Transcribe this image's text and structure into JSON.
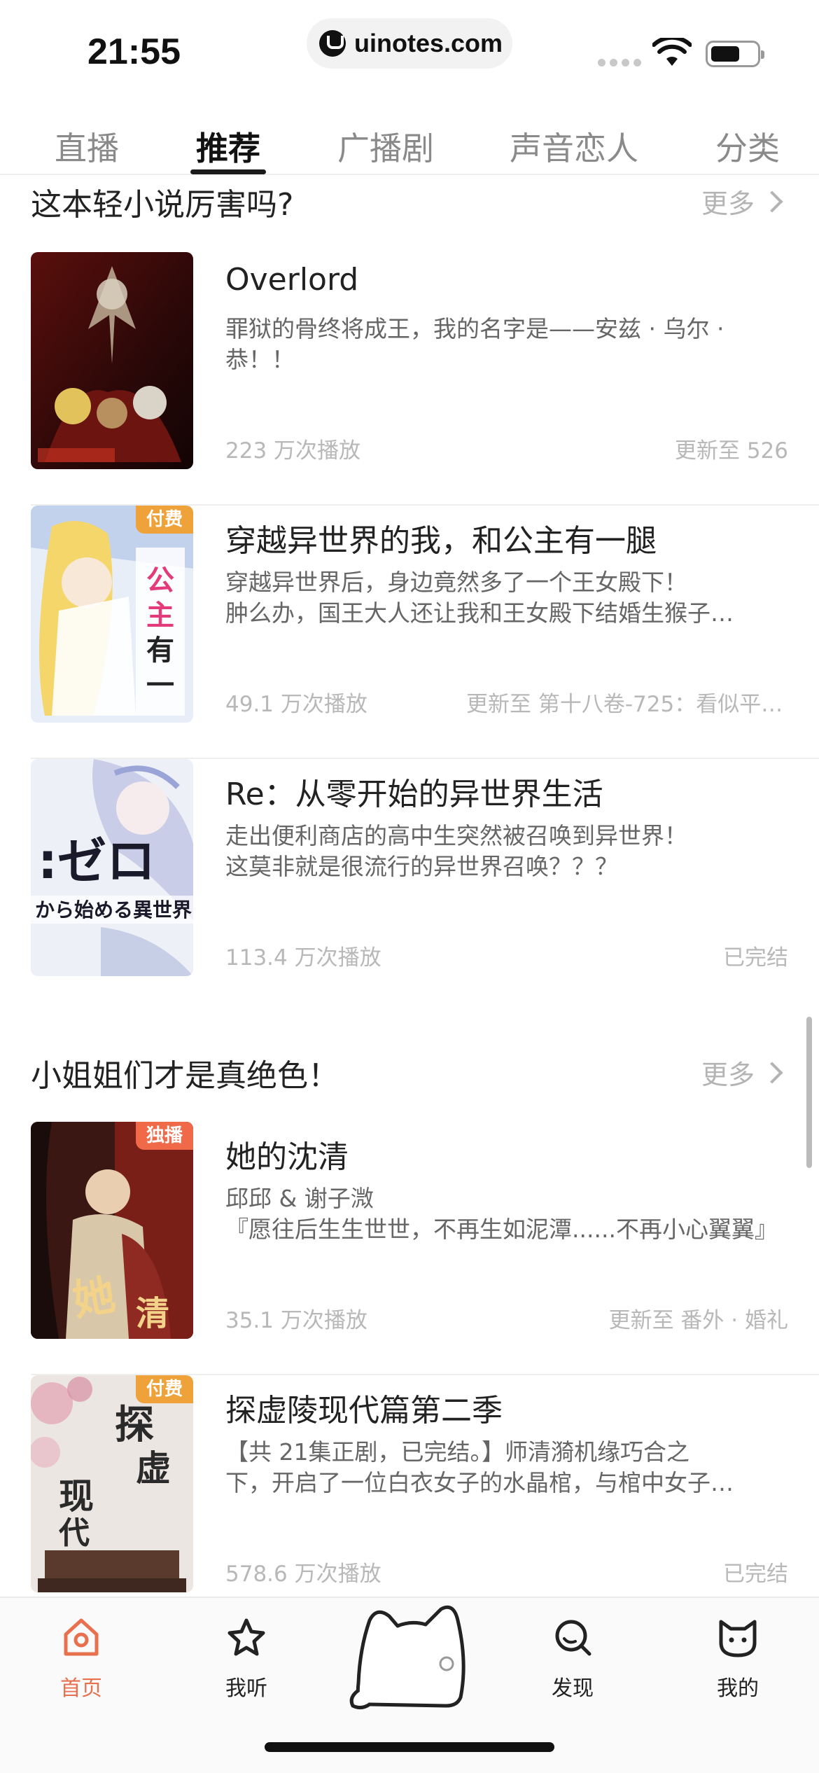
{
  "status_bar": {
    "time": "21:55",
    "url": "uinotes.com"
  },
  "top_tabs": [
    {
      "label": "直播",
      "active": false
    },
    {
      "label": "推荐",
      "active": true
    },
    {
      "label": "广播剧",
      "active": false
    },
    {
      "label": "声音恋人",
      "active": false
    },
    {
      "label": "分类",
      "active": false
    }
  ],
  "sections": [
    {
      "title": "这本轻小说厉害吗?",
      "more_label": "更多",
      "items": [
        {
          "title": "Overlord",
          "desc_line1": "罪狱的骨终将成王，我的名字是——安兹 · 乌尔 ·",
          "desc_line2": "恭！！",
          "plays": "223 万次播放",
          "update": "更新至 526",
          "badge": "",
          "cover_colors": [
            "#3a0d0d",
            "#8a1a14",
            "#c9a23a"
          ]
        },
        {
          "title": "穿越异世界的我，和公主有一腿",
          "desc_line1": "穿越异世界后，身边竟然多了一个王女殿下！",
          "desc_line2": "肿么办，国王大人还让我和王女殿下结婚生猴子…",
          "plays": "49.1 万次播放",
          "update": "更新至 第十八卷-725：看似平静…",
          "badge": "付费",
          "cover_colors": [
            "#dfe8f5",
            "#f3d36b",
            "#ffffff"
          ]
        },
        {
          "title": "Re：从零开始的异世界生活",
          "desc_line1": "走出便利商店的高中生突然被召唤到异世界！",
          "desc_line2": "这莫非就是很流行的异世界召唤？？？",
          "plays": "113.4 万次播放",
          "update": "已完结",
          "badge": "",
          "cover_colors": [
            "#eef0f8",
            "#c9cde8",
            "#7a86c0"
          ]
        }
      ]
    },
    {
      "title": "小姐姐们才是真绝色！",
      "more_label": "更多",
      "items": [
        {
          "title": "她的沈清",
          "desc_line1": "邱邱 & 谢子溦",
          "desc_line2": "『愿往后生生世世，不再生如泥潭......不再小心翼翼』",
          "plays": "35.1 万次播放",
          "update": "更新至 番外 · 婚礼",
          "badge": "独播",
          "cover_colors": [
            "#2a1512",
            "#7a1f18",
            "#d9a55a"
          ]
        },
        {
          "title": "探虚陵现代篇第二季",
          "desc_line1": "【共 21集正剧，已完结。】师清漪机缘巧合之",
          "desc_line2": "下，开启了一位白衣女子的水晶棺，与棺中女子…",
          "plays": "578.6 万次播放",
          "update": "已完结",
          "badge": "付费",
          "cover_colors": [
            "#ece6e2",
            "#d8a7b5",
            "#5b3a2e"
          ]
        }
      ]
    }
  ],
  "bottom_nav": [
    {
      "label": "首页",
      "icon": "home-icon",
      "active": true
    },
    {
      "label": "我听",
      "icon": "star-icon",
      "active": false
    },
    {
      "label": "发现",
      "icon": "search-icon",
      "active": false
    },
    {
      "label": "我的",
      "icon": "cat-face-icon",
      "active": false
    }
  ],
  "colors": {
    "accent": "#e8704e",
    "badge_paid": "#f0a23a",
    "badge_exclusive": "#f06a4a"
  }
}
